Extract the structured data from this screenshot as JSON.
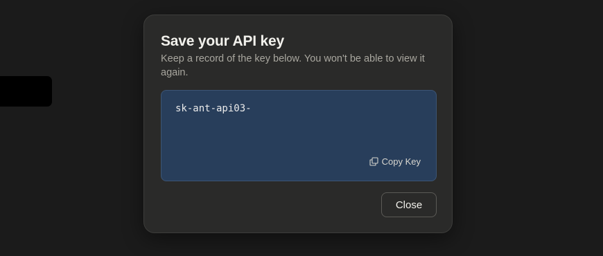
{
  "modal": {
    "title": "Save your API key",
    "description": "Keep a record of the key below. You won't be able to view it again.",
    "api_key": "sk-ant-api03-",
    "copy_label": "Copy Key",
    "copy_icon": "copy-icon",
    "close_label": "Close"
  },
  "colors": {
    "background": "#1b1b1b",
    "modal_bg": "#2a2a29",
    "key_box_bg": "#283e5b",
    "text_primary": "#f2f1ec",
    "text_secondary": "#a9a79f"
  }
}
